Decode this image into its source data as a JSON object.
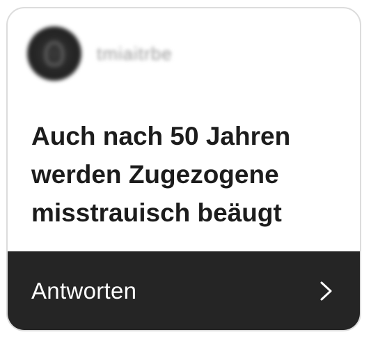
{
  "source": {
    "name": "tmiaitrbe",
    "avatar_icon": "blurred-logo-avatar"
  },
  "article": {
    "headline": "Auch nach 50 Jahren werden Zugezogene misstrauisch beäugt"
  },
  "reply": {
    "label": "Antworten",
    "icon": "chevron-right-icon"
  },
  "colors": {
    "bar_background": "#252525",
    "headline_text": "#1c1c1c",
    "card_border": "#dcdcdc"
  }
}
